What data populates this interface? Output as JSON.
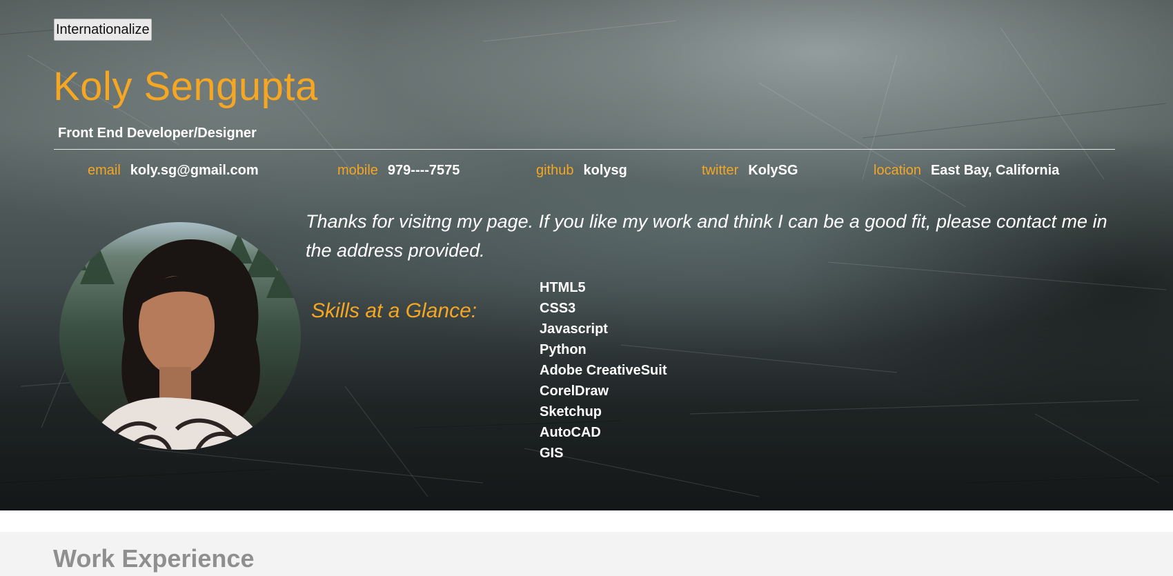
{
  "header": {
    "internationalize_label": "Internationalize",
    "name": "Koly Sengupta",
    "role": "Front End Developer/Designer"
  },
  "contacts": [
    {
      "key": "email",
      "value": "koly.sg@gmail.com"
    },
    {
      "key": "mobile",
      "value": "979----7575"
    },
    {
      "key": "github",
      "value": "kolysg"
    },
    {
      "key": "twitter",
      "value": "KolySG"
    },
    {
      "key": "location",
      "value": "East Bay, California"
    }
  ],
  "welcome_message": "Thanks for visitng my page. If you like my work and think I can be a good fit, please contact me in the address provided.",
  "skills": {
    "heading": "Skills at a Glance:",
    "items": [
      "HTML5",
      "CSS3",
      "Javascript",
      "Python",
      "Adobe CreativeSuit",
      "CorelDraw",
      "Sketchup",
      "AutoCAD",
      "GIS"
    ]
  },
  "work": {
    "title": "Work Experience"
  },
  "colors": {
    "accent": "#f5a623",
    "text_light": "#ffffff",
    "section_heading": "#8f8f8f",
    "section_bg": "#f3f3f3"
  }
}
